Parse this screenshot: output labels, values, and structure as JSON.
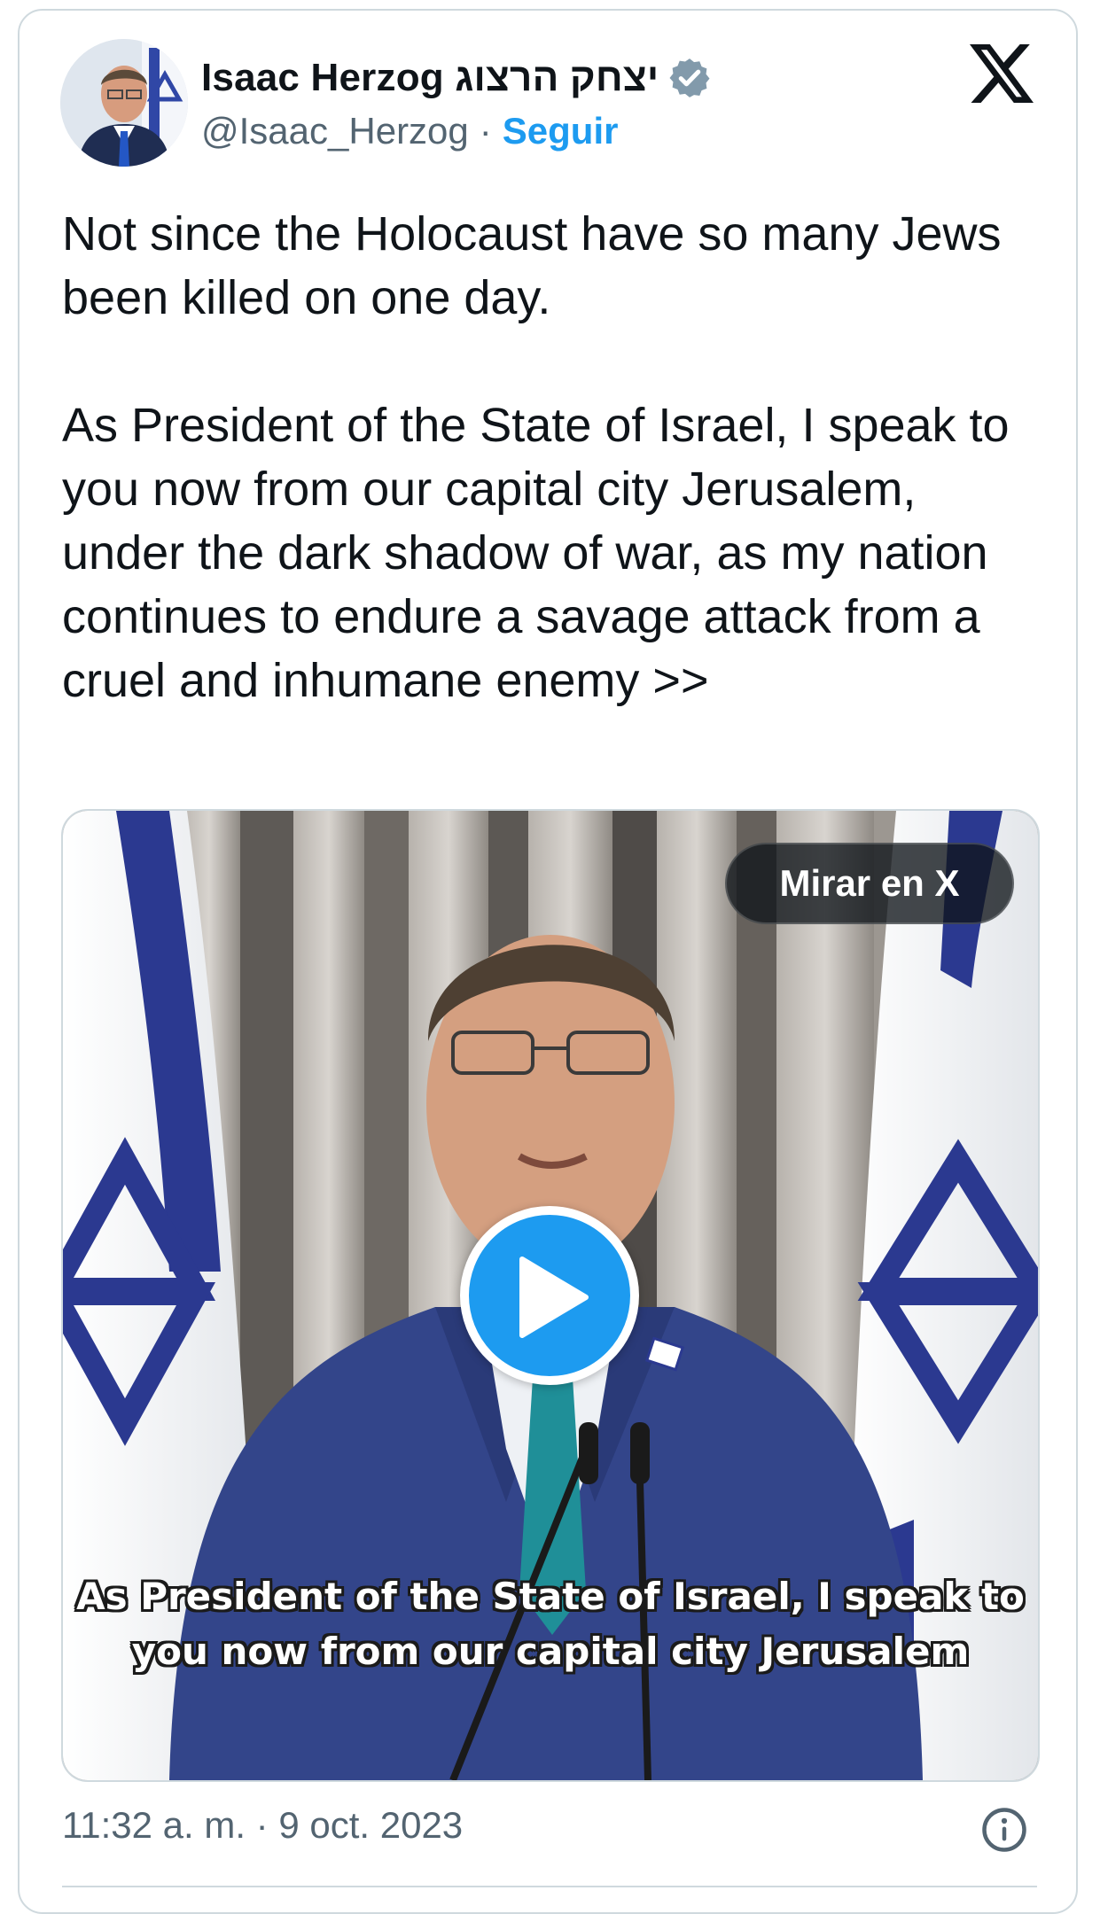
{
  "author": {
    "display_name": "Isaac Herzog יצחק הרצוג",
    "handle": "@Isaac_Herzog",
    "separator": "·",
    "follow_label": "Seguir",
    "verified": true
  },
  "tweet": {
    "text": "Not since the Holocaust have so many Jews been killed on one day.\n\nAs President of the State of Israel, I speak to you now from our capital city Jerusalem, under the dark shadow of war, as my nation continues to endure a savage attack from a cruel and inhumane enemy >>"
  },
  "media": {
    "watch_label": "Mirar en X",
    "subtitle_line1": "As President of the State of Israel, I speak to",
    "subtitle_line2": "you now from our capital city Jerusalem"
  },
  "footer": {
    "timestamp": "11:32 a. m. · 9 oct. 2023"
  },
  "icons": {
    "brand": "x-logo-icon",
    "verified": "verified-badge-icon",
    "play": "play-icon",
    "info": "info-icon"
  },
  "colors": {
    "accent": "#1d9bf0",
    "text": "#0f1419",
    "secondary_text": "#536471",
    "border": "#cfd9de",
    "flag_blue": "#2b3990"
  }
}
